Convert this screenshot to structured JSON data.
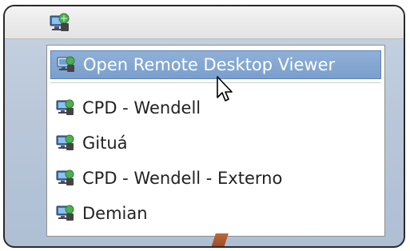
{
  "panel": {
    "launcher_icon": "remote-desktop-icon"
  },
  "menu": {
    "header_item": {
      "label": "Open Remote Desktop Viewer",
      "icon": "remote-desktop-icon"
    },
    "items": [
      {
        "label": "CPD - Wendell",
        "icon": "remote-desktop-icon"
      },
      {
        "label": "Gituá",
        "icon": "remote-desktop-icon"
      },
      {
        "label": "CPD - Wendell - Externo",
        "icon": "remote-desktop-icon"
      },
      {
        "label": "Demian",
        "icon": "remote-desktop-icon"
      }
    ]
  },
  "colors": {
    "highlight": "#7a9fcc",
    "highlight_text": "#ffffff",
    "text": "#222222",
    "desktop": "#b9c7d9"
  }
}
